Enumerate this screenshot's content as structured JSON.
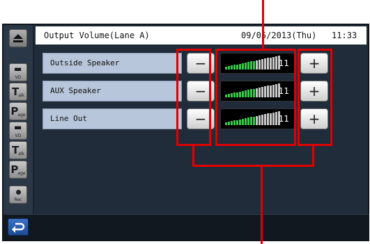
{
  "header": {
    "title": "Output Volume(Lane A)",
    "datetime": "09/05/2013(Thu)   11:33"
  },
  "sidebar": {
    "buttons": [
      {
        "name": "vd-button-1",
        "main": "",
        "sub": "VD"
      },
      {
        "name": "talk-button-1",
        "main": "T",
        "sub": "alk"
      },
      {
        "name": "page-button-1",
        "main": "P",
        "sub": "age"
      },
      {
        "name": "vd-button-2",
        "main": "",
        "sub": "VD"
      },
      {
        "name": "talk-button-2",
        "main": "T",
        "sub": "alk"
      },
      {
        "name": "page-button-2",
        "main": "P",
        "sub": "age"
      },
      {
        "name": "rec-button",
        "main": "",
        "sub": "Rec"
      }
    ]
  },
  "rows": [
    {
      "label": "Outside Speaker",
      "value": "11",
      "level": 11,
      "minus": "−",
      "plus": "+"
    },
    {
      "label": "AUX Speaker",
      "value": "11",
      "level": 11,
      "minus": "−",
      "plus": "+"
    },
    {
      "label": "Line Out",
      "value": "11",
      "level": 11,
      "minus": "−",
      "plus": "+"
    }
  ],
  "meter": {
    "max_level": 20,
    "active_color": "#38c84a",
    "inactive_color": "#c8c8c8"
  },
  "colors": {
    "callout": "#e00000",
    "back_button": "#2a5fb3"
  },
  "icons": {
    "back": "return-arrow-icon",
    "top": "eject-icon"
  }
}
